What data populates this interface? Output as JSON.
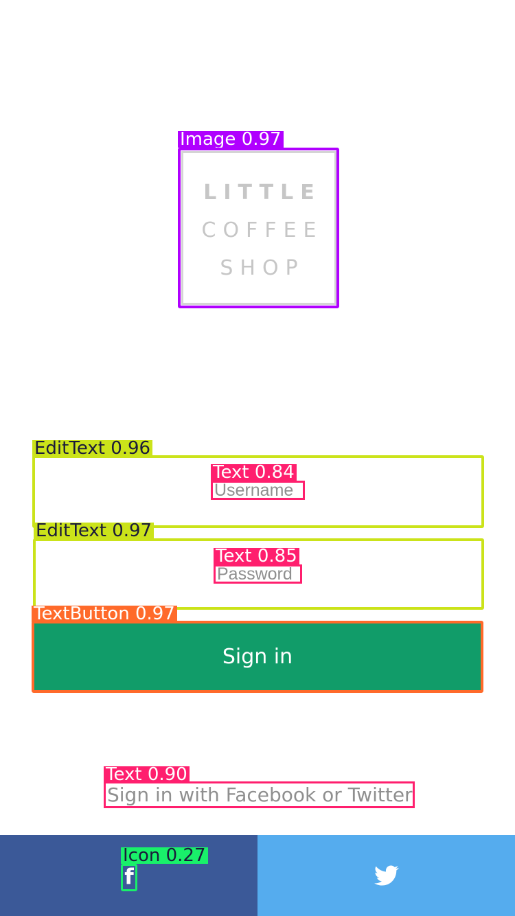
{
  "logo": {
    "line1": "LITTLE",
    "line2": "COFFEE",
    "line3": "SHOP",
    "label": "Image 0.97"
  },
  "form": {
    "username_placeholder": "Username",
    "password_placeholder": "Password",
    "username_label": "EditText 0.96",
    "password_label": "EditText 0.97",
    "username_text_label": "Text 0.84",
    "password_text_label": "Text 0.85",
    "signin_label": "Sign in",
    "signin_detect_label": "TextButton 0.97"
  },
  "social": {
    "caption": "Sign in with Facebook or Twitter",
    "caption_label": "Text 0.90",
    "facebook_icon": "f",
    "facebook_icon_label": "Icon 0.27",
    "facebook_color": "#3b5998",
    "twitter_color": "#55acee"
  },
  "colors": {
    "signin_button": "#119c69"
  }
}
